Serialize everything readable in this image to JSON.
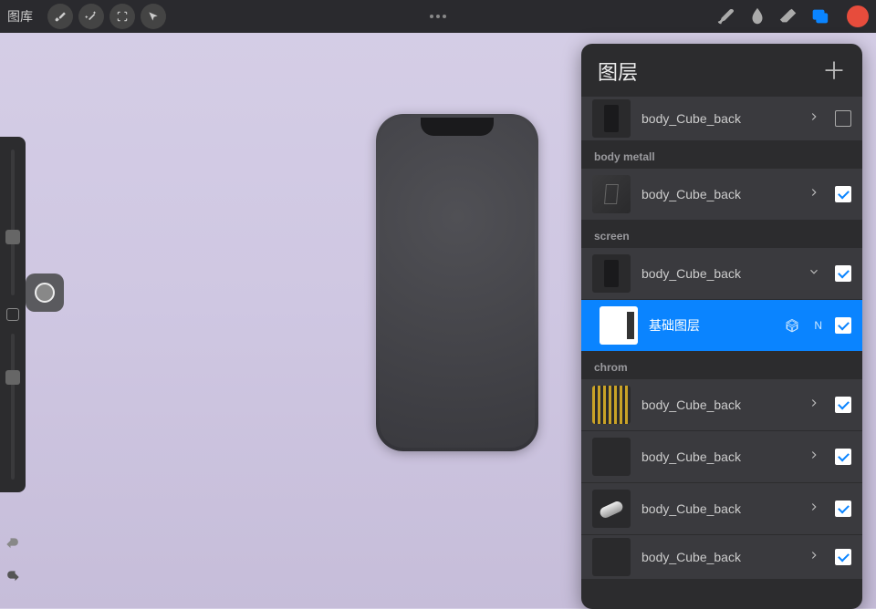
{
  "topbar": {
    "gallery_label": "图库",
    "color_chip": "#e74c3c"
  },
  "panel": {
    "title": "图层",
    "add_glyph": "＋"
  },
  "groups": [
    {
      "name": "",
      "layers": [
        {
          "name": "body_Cube_back",
          "checked": false,
          "thumb": "dark-rect",
          "chev": "right",
          "partial": true
        }
      ]
    },
    {
      "name": "body metall",
      "layers": [
        {
          "name": "body_Cube_back",
          "checked": true,
          "thumb": "metal",
          "chev": "right"
        }
      ]
    },
    {
      "name": "screen",
      "layers": [
        {
          "name": "body_Cube_back",
          "checked": true,
          "thumb": "dark-rect",
          "chev": "down"
        },
        {
          "name": "基础图层",
          "checked": true,
          "thumb": "white",
          "selected": true,
          "blend": "N",
          "cube": true,
          "indented": true
        }
      ]
    },
    {
      "name": "chrom",
      "layers": [
        {
          "name": "body_Cube_back",
          "checked": true,
          "thumb": "stripes",
          "chev": "right"
        },
        {
          "name": "body_Cube_back",
          "checked": true,
          "thumb": "plain",
          "chev": "right"
        },
        {
          "name": "body_Cube_back",
          "checked": true,
          "thumb": "cyl",
          "chev": "right"
        },
        {
          "name": "body_Cube_back",
          "checked": true,
          "thumb": "plain",
          "chev": "right",
          "partial": true
        }
      ]
    }
  ]
}
